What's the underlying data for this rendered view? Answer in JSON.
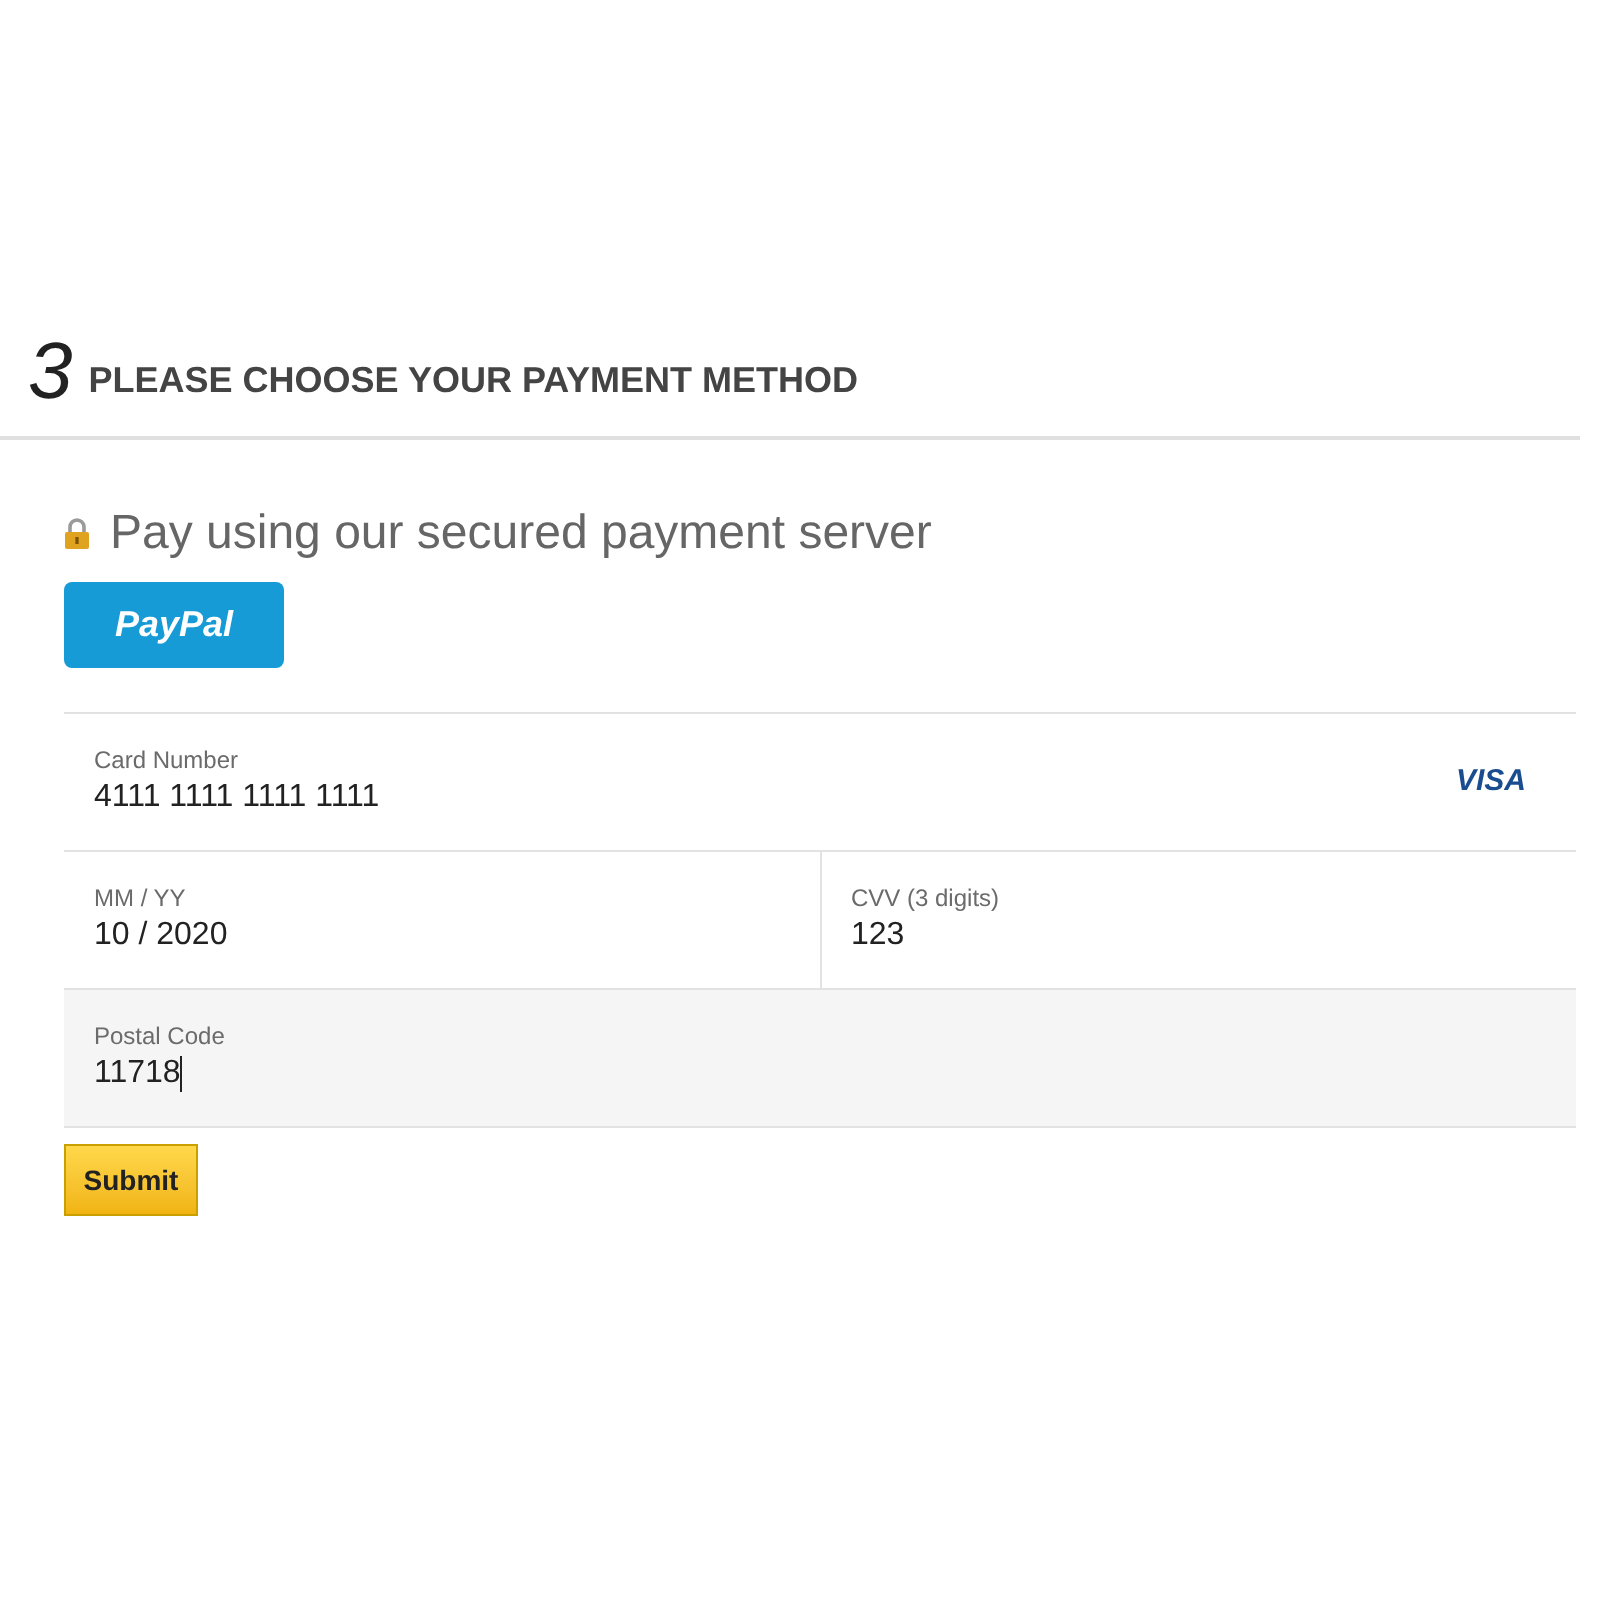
{
  "step": {
    "number": "3",
    "title": "PLEASE CHOOSE YOUR PAYMENT METHOD"
  },
  "secure_note": "Pay using our secured payment server",
  "paypal_button": "PayPal",
  "fields": [
    {
      "label": "Card Number",
      "value": "4111 1111 1111 1111",
      "focused": false,
      "card_brand": "VISA"
    },
    {
      "label": "MM / YY",
      "value": "10 / 2020",
      "focused": false
    },
    {
      "label": "CVV (3 digits)",
      "value": "123",
      "focused": false
    },
    {
      "label": "Postal Code",
      "value": "11718",
      "focused": true
    }
  ],
  "submit_button": "Submit"
}
